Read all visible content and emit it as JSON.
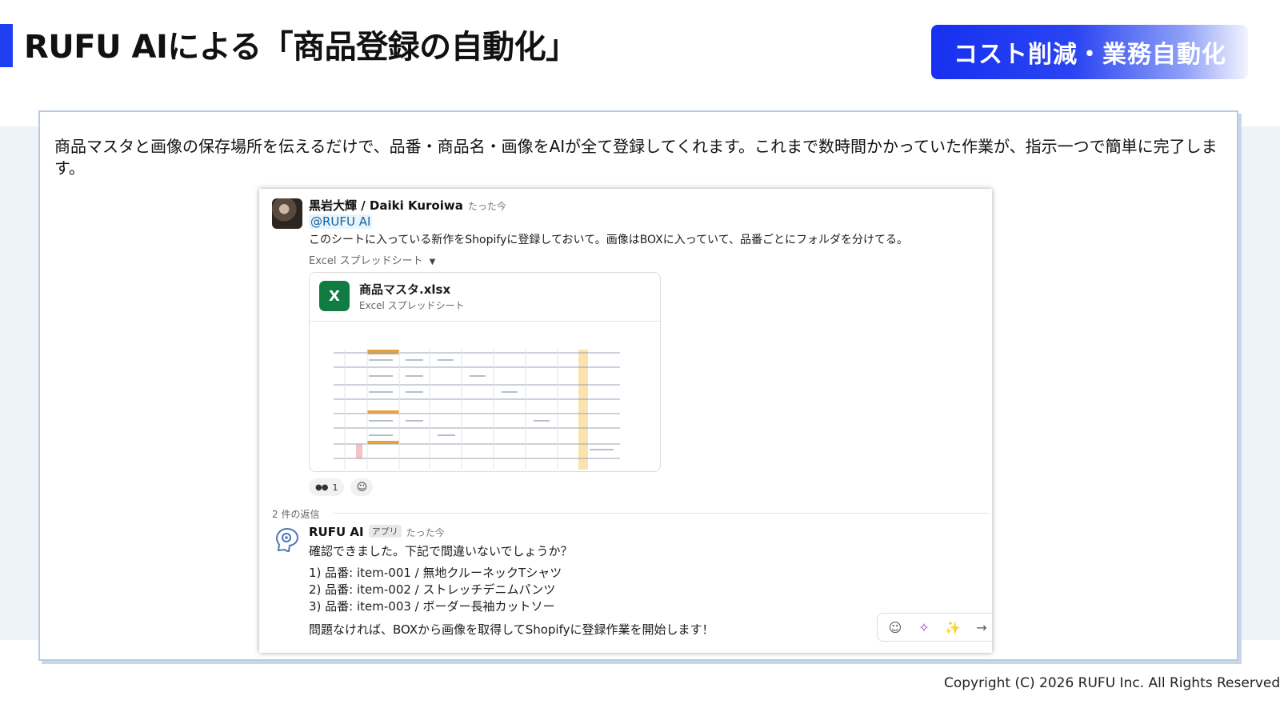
{
  "slide": {
    "title": "RUFU AIによる「商品登録の自動化」",
    "tag": "コスト削減・業務自動化",
    "description": "商品マスタと画像の保存場所を伝えるだけで、品番・商品名・画像をAIが全て登録してくれます。これまで数時間かかっていた作業が、指示一つで簡単に完了します。",
    "copyright": "Copyright (C) 2026 RUFU Inc. All Rights Reserved."
  },
  "colors": {
    "accent": "#1f3ff0",
    "excel_green": "#107c41",
    "mention_blue": "#1264a3"
  },
  "chat": {
    "message": {
      "author": "黒岩大輝 / Daiki Kuroiwa",
      "time": "たった今",
      "mention": "@RUFU AI",
      "text": "このシートに入っている新作をShopifyに登録しておいて。画像はBOXに入っていて、品番ごとにフォルダを分けてる。",
      "attachment_kind": "Excel スプレッドシート",
      "file": {
        "icon_letter": "X",
        "name": "商品マスタ.xlsx",
        "type": "Excel スプレッドシート"
      },
      "reaction_icon": "eyes-icon",
      "reaction_count": "1",
      "add_reaction_icon": "add-emoji-icon"
    },
    "reply_count": "2 件の返信",
    "reply": {
      "author": "RUFU AI",
      "badge": "アプリ",
      "time": "たった今",
      "text": "確認できました。下記で間違いないでしょうか？",
      "items": [
        "1) 品番: item-001 / 無地クルーネックTシャツ",
        "2) 品番: item-002 / ストレッチデニムパンツ",
        "3) 品番: item-003 / ボーダー長袖カットソー"
      ],
      "footer": "問題なければ、BOXから画像を取得してShopifyに登録作業を開始します！"
    },
    "toolbar": [
      "emoji-icon",
      "sparkle-magic-icon",
      "sparkles-icon",
      "forward-arrow-icon"
    ]
  }
}
